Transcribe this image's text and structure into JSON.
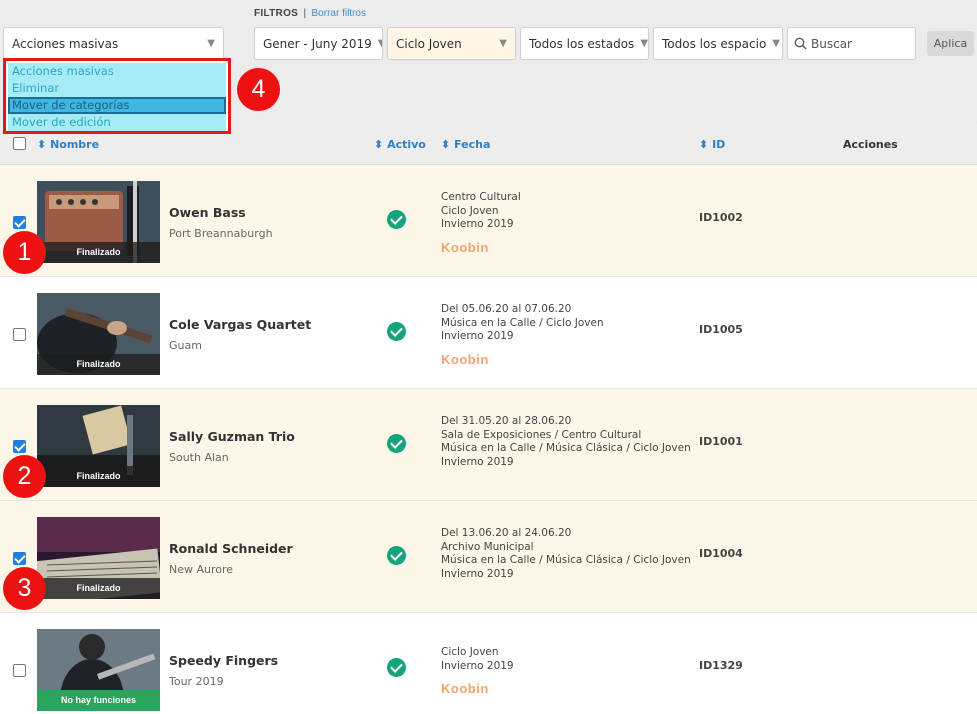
{
  "filters": {
    "label": "FILTROS",
    "separator": "|",
    "clear_link": "Borrar filtros",
    "bulk_select": "Acciones masivas",
    "period": "Gener - Juny 2019",
    "cycle": "Ciclo Joven",
    "states": "Todos los estados",
    "spaces": "Todos los espacio",
    "search_placeholder": "Buscar",
    "apply": "Aplica"
  },
  "dropdown": {
    "options": [
      "Acciones masivas",
      "Eliminar",
      "Mover de categorías",
      "Mover de edición"
    ],
    "selected_index": 2
  },
  "badges": [
    "1",
    "2",
    "3",
    "4"
  ],
  "table": {
    "headers": {
      "name": "Nombre",
      "active": "Activo",
      "date": "Fecha",
      "id": "ID",
      "actions": "Acciones",
      "sort_glyph": "⬍"
    },
    "rows": [
      {
        "checked": true,
        "title": "Owen Bass",
        "place": "Port Breannaburgh",
        "status": "Finalizado",
        "date_lines": [
          "Centro Cultural",
          "Ciclo Joven",
          "Invierno 2019"
        ],
        "logo": "Koobin",
        "id": "ID1002"
      },
      {
        "checked": false,
        "title": "Cole Vargas Quartet",
        "place": "Guam",
        "status": "Finalizado",
        "date_lines": [
          "Del 05.06.20 al 07.06.20",
          "Música en la Calle / Ciclo Joven",
          "Invierno 2019"
        ],
        "logo": "Koobin",
        "id": "ID1005"
      },
      {
        "checked": true,
        "title": "Sally Guzman Trio",
        "place": "South Alan",
        "status": "Finalizado",
        "date_lines": [
          "Del 31.05.20 al 28.06.20",
          "Sala de Exposiciones / Centro Cultural",
          "Música en la Calle / Música Clásica / Ciclo Joven",
          "Invierno 2019"
        ],
        "logo": "",
        "id": "ID1001"
      },
      {
        "checked": true,
        "title": "Ronald Schneider",
        "place": "New Aurore",
        "status": "Finalizado",
        "date_lines": [
          "Del 13.06.20 al 24.06.20",
          "Archivo Municipal",
          "Música en la Calle / Música Clásica / Ciclo Joven",
          "Invierno 2019"
        ],
        "logo": "",
        "id": "ID1004"
      },
      {
        "checked": false,
        "title": "Speedy Fingers",
        "place": "Tour 2019",
        "status": "No hay funciones",
        "date_lines": [
          "Ciclo Joven",
          "Invierno 2019"
        ],
        "logo": "Koobin",
        "id": "ID1329"
      }
    ]
  },
  "colors": {
    "accent": "#2f7fc6",
    "active": "#16a37b",
    "highlight_row": "#fdf7e9",
    "badge": "#ee1111"
  }
}
